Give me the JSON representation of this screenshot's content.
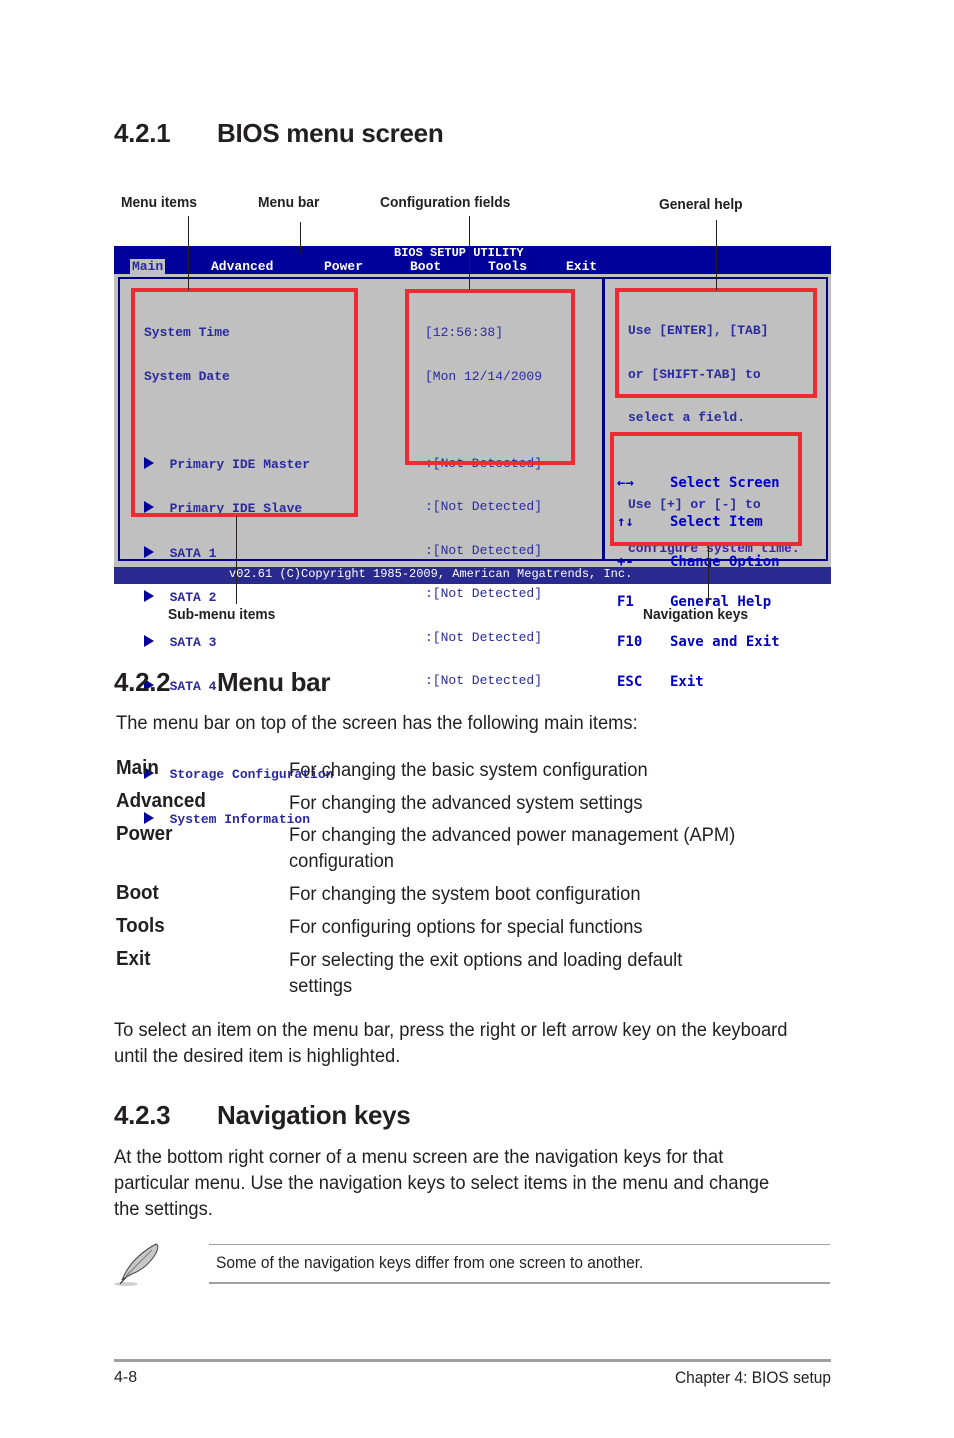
{
  "sections": {
    "s1": {
      "number": "4.2.1",
      "title": "BIOS menu screen"
    },
    "s2": {
      "number": "4.2.2",
      "title": "Menu bar",
      "intro": "The menu bar on top of the screen has the following main items:"
    },
    "s3": {
      "number": "4.2.3",
      "title": "Navigation keys"
    }
  },
  "callouts": {
    "menu_items": "Menu items",
    "menu_bar": "Menu bar",
    "config_fields": "Configuration fields",
    "general_help": "General help",
    "sub_menu_items": "Sub-menu items",
    "navigation_keys": "Navigation keys"
  },
  "bios": {
    "title": "BIOS SETUP UTILITY",
    "menu": [
      "Main",
      "Advanced",
      "Power",
      "Boot",
      "Tools",
      "Exit"
    ],
    "selected_menu": "Main",
    "items": [
      "System Time",
      "System Date"
    ],
    "submenus": [
      "Primary IDE Master",
      "Primary IDE Slave",
      "SATA 1",
      "SATA 2",
      "SATA 3",
      "SATA 4",
      "Storage Configuration",
      "System Information"
    ],
    "fields": [
      "[12:56:38]",
      "[Mon 12/14/2009",
      ":[Not Detected]",
      ":[Not Detected]",
      ":[Not Detected]",
      ":[Not Detected]",
      ":[Not Detected]",
      ":[Not Detected]"
    ],
    "help": [
      "Use [ENTER], [TAB]",
      "or [SHIFT-TAB] to",
      "select a field.",
      "",
      "Use [+] or [-] to",
      "configure system time."
    ],
    "nav_keys": [
      {
        "key": "←→",
        "action": "Select Screen"
      },
      {
        "key": "↑↓",
        "action": "Select Item"
      },
      {
        "key": "+-",
        "action": "Change Option"
      },
      {
        "key": "F1",
        "action": "General Help"
      },
      {
        "key": "F10",
        "action": "Save and Exit"
      },
      {
        "key": "ESC",
        "action": "Exit"
      }
    ],
    "copyright": "v02.61 (C)Copyright 1985-2009, American Megatrends, Inc.",
    "colors": {
      "bar": "#00009a",
      "panel": "#c0c0c0",
      "text": "#2a2aa0",
      "highlight": "#ee2a33"
    }
  },
  "menu_descriptions": [
    {
      "term": "Main",
      "desc": "For changing the basic system configuration"
    },
    {
      "term": "Advanced",
      "desc": "For changing the advanced system settings"
    },
    {
      "term": "Power",
      "desc": "For changing the advanced power management (APM)",
      "desc2": "configuration"
    },
    {
      "term": "Boot",
      "desc": "For changing the system boot configuration"
    },
    {
      "term": "Tools",
      "desc": "For configuring options for special functions"
    },
    {
      "term": "Exit",
      "desc": "For selecting the exit options and loading default",
      "desc2": "settings"
    }
  ],
  "select_paragraph": [
    "To select an item on the menu bar, press the right or left arrow key on the keyboard",
    "until the desired item is highlighted."
  ],
  "nav_paragraph": [
    "At the bottom right corner of a menu screen are the navigation keys for that",
    "particular menu. Use the navigation keys to select items in the menu and change",
    "the settings."
  ],
  "note": {
    "icon": "feather-pen-icon",
    "text": "Some of the navigation keys differ from one screen to another."
  },
  "page_footer": {
    "page": "4-8",
    "chapter": "Chapter 4: BIOS setup"
  }
}
